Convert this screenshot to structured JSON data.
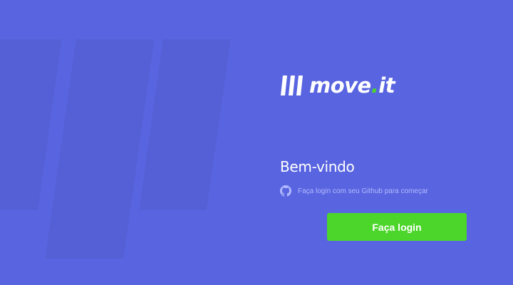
{
  "brand": {
    "name_part1": "move",
    "name_dot": ".",
    "name_part2": "it",
    "logo_icon": "triple-slash-logo-icon"
  },
  "welcome": {
    "title": "Bem-vindo",
    "hint_icon": "github-icon",
    "hint_text": "Faça login com seu Github para começar"
  },
  "login": {
    "button_label": "Faça login"
  },
  "colors": {
    "background": "#5965E0",
    "background_stripes": "#5560D6",
    "accent_green": "#4CD62B",
    "hint_text": "#B2B9FF",
    "text": "#FFFFFF"
  }
}
